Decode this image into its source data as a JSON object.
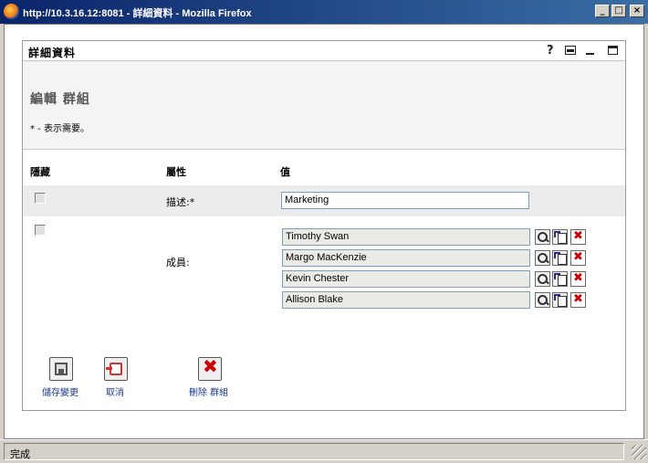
{
  "window": {
    "title": "http://10.3.16.12:8081 - 詳細資料 - Mozilla Firefox"
  },
  "panel": {
    "title": "詳細資料",
    "help": "?"
  },
  "page": {
    "heading": "編輯 群組",
    "required_note": "* - 表示需要。"
  },
  "columns": {
    "hide": "隱藏",
    "attribute": "屬性",
    "value": "值"
  },
  "description": {
    "label": "描述:*",
    "value": "Marketing"
  },
  "members": {
    "label": "成員:",
    "items": [
      "Timothy Swan",
      "Margo MacKenzie",
      "Kevin Chester",
      "Allison Blake"
    ]
  },
  "actions": {
    "save": "儲存變更",
    "cancel": "取消",
    "delete": "刪除 群組"
  },
  "statusbar": {
    "text": "完成"
  },
  "icons": {
    "delete_glyph": "✖"
  }
}
